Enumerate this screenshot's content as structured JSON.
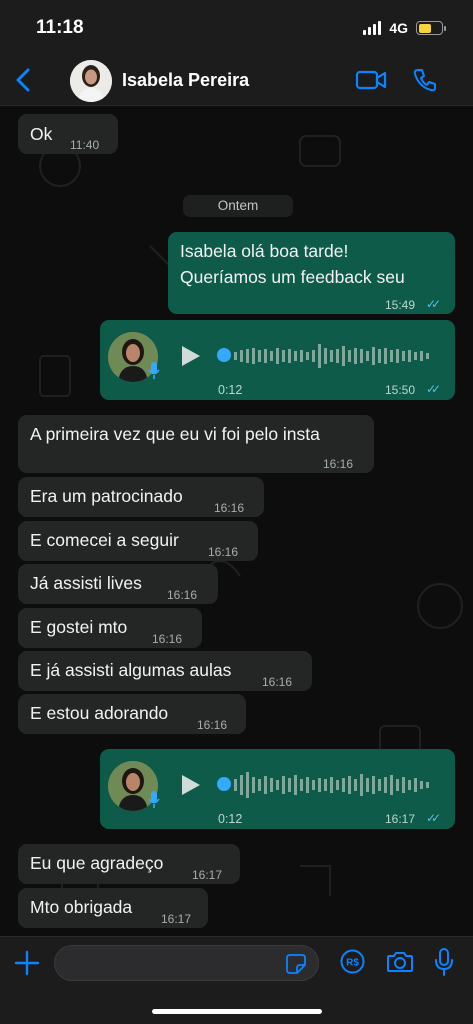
{
  "status": {
    "time": "11:18",
    "network": "4G"
  },
  "header": {
    "contact_name": "Isabela Pereira"
  },
  "chat": {
    "date_divider": "Ontem",
    "messages": [
      {
        "text": "Ok",
        "time": "11:40"
      },
      {
        "text": "Isabela olá boa tarde!",
        "text2": "Queríamos um feedback seu",
        "time": "15:49"
      },
      {
        "duration": "0:12",
        "time": "15:50"
      },
      {
        "text": "A primeira vez que eu vi foi pelo insta",
        "time": "16:16"
      },
      {
        "text": "Era um patrocinado",
        "time": "16:16"
      },
      {
        "text": "E comecei a seguir",
        "time": "16:16"
      },
      {
        "text": "Já assisti lives",
        "time": "16:16"
      },
      {
        "text": "E gostei mto",
        "time": "16:16"
      },
      {
        "text": "E já assisti algumas aulas",
        "time": "16:16"
      },
      {
        "text": "E estou adorando",
        "time": "16:16"
      },
      {
        "duration": "0:12",
        "time": "16:17"
      },
      {
        "text": "Eu que agradeço",
        "time": "16:17"
      },
      {
        "text": "Mto obrigada",
        "time": "16:17"
      }
    ]
  },
  "colors": {
    "accent": "#0a84ff",
    "outgoing_bubble": "#0f5b49",
    "incoming_bubble": "#242626",
    "read_ticks": "#53bdeb"
  },
  "icons": [
    "back-chevron-icon",
    "video-call-icon",
    "phone-icon",
    "play-icon",
    "mic-icon",
    "plus-icon",
    "sticker-icon",
    "payment-icon",
    "camera-icon"
  ]
}
